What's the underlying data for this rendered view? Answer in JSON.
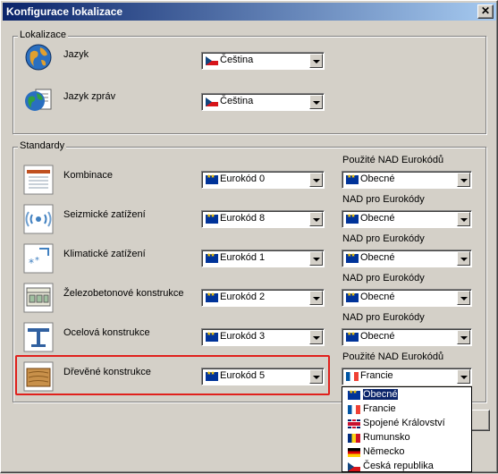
{
  "window": {
    "title": "Konfigurace lokalizace",
    "close_glyph": "✕"
  },
  "lokalizace": {
    "title": "Lokalizace",
    "rows": [
      {
        "label": "Jazyk",
        "value": "Čeština",
        "icon": "globe-icon"
      },
      {
        "label": "Jazyk zpráv",
        "value": "Čeština",
        "icon": "globe-document-icon"
      }
    ]
  },
  "standardy": {
    "title": "Standardy",
    "rows": [
      {
        "label": "Kombinace",
        "code": "Eurokód 0",
        "nad_header": "Použité NAD Eurokódů",
        "nad": "Obecné",
        "nad_flag": "eu",
        "icon": "combination-icon"
      },
      {
        "label": "Seizmické zatížení",
        "code": "Eurokód 8",
        "nad_header": "NAD pro Eurokódy",
        "nad": "Obecné",
        "nad_flag": "eu",
        "icon": "seismic-icon"
      },
      {
        "label": "Klimatické zatížení",
        "code": "Eurokód 1",
        "nad_header": "NAD pro Eurokódy",
        "nad": "Obecné",
        "nad_flag": "eu",
        "icon": "climate-icon"
      },
      {
        "label": "Železobetonové konstrukce",
        "code": "Eurokód 2",
        "nad_header": "NAD pro Eurokódy",
        "nad": "Obecné",
        "nad_flag": "eu",
        "icon": "concrete-icon"
      },
      {
        "label": "Ocelová konstrukce",
        "code": "Eurokód 3",
        "nad_header": "NAD pro Eurokódy",
        "nad": "Obecné",
        "nad_flag": "eu",
        "icon": "steel-icon"
      },
      {
        "label": "Dřevěné konstrukce",
        "code": "Eurokód 5",
        "nad_header": "Použité NAD Eurokódů",
        "nad": "Francie",
        "nad_flag": "fr",
        "icon": "timber-icon"
      }
    ]
  },
  "dropdown": {
    "items": [
      {
        "label": "Obecné",
        "flag": "eu"
      },
      {
        "label": "Francie",
        "flag": "fr"
      },
      {
        "label": "Spojené Království",
        "flag": "gb"
      },
      {
        "label": "Rumunsko",
        "flag": "ro"
      },
      {
        "label": "Německo",
        "flag": "de"
      },
      {
        "label": "Česká republika",
        "flag": "cz"
      }
    ],
    "highlighted_index": 0
  }
}
